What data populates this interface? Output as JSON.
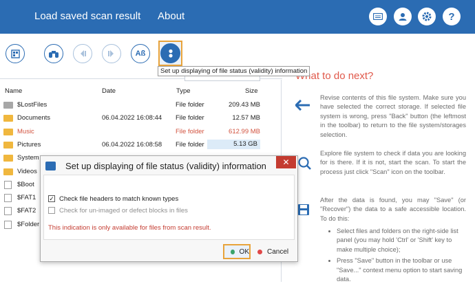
{
  "topbar": {
    "menu": [
      "Load saved scan result",
      "About"
    ],
    "icons": [
      "keyboard-icon",
      "user-icon",
      "gear-icon",
      "help-icon"
    ],
    "help_glyph": "?"
  },
  "toolbar": {
    "buttons": [
      "view-mode-icon",
      "binoculars-icon",
      "back-icon",
      "forward-icon",
      "case-sensitive-icon",
      "file-status-icon"
    ],
    "case_label": "Aß",
    "tooltip": "Set up displaying of file status (validity) information"
  },
  "filelist": {
    "columns": {
      "name": "Name",
      "date": "Date",
      "type": "Type",
      "size": "Size"
    },
    "rows": [
      {
        "name": "$LostFiles",
        "date": "",
        "type": "File folder",
        "size": "209.43 MB",
        "icon": "folder-gray"
      },
      {
        "name": "Documents",
        "date": "06.04.2022 16:08:44",
        "type": "File folder",
        "size": "12.57 MB",
        "icon": "folder"
      },
      {
        "name": "Music",
        "date": "",
        "type": "File folder",
        "size": "612.99 MB",
        "icon": "folder",
        "status": "red"
      },
      {
        "name": "Pictures",
        "date": "06.04.2022 16:08:58",
        "type": "File folder",
        "size": "5.13 GB",
        "icon": "folder",
        "highlight": true
      },
      {
        "name": "System",
        "date": "",
        "type": "",
        "size": "",
        "icon": "folder"
      },
      {
        "name": "Videos",
        "date": "",
        "type": "",
        "size": "",
        "icon": "folder"
      },
      {
        "name": "$Boot",
        "date": "",
        "type": "",
        "size": "",
        "icon": "file"
      },
      {
        "name": "$FAT1",
        "date": "",
        "type": "",
        "size": "",
        "icon": "file"
      },
      {
        "name": "$FAT2",
        "date": "",
        "type": "",
        "size": "",
        "icon": "file"
      },
      {
        "name": "$Folder",
        "date": "",
        "type": "",
        "size": "",
        "icon": "file"
      }
    ]
  },
  "help": {
    "title": "What to do next?",
    "p1": "Revise contents of this file system. Make sure you have selected the correct storage. If selected file system is wrong, press \"Back\" button (the leftmost in the toolbar) to return to the file system/storages selection.",
    "p2": "Explore file system to check if data you are looking for is there. If it is not, start the scan. To start the process just click \"Scan\" icon on the toolbar.",
    "p3": "After the data is found, you may \"Save\" (or \"Recover\") the data to a safe accessible location. To do this:",
    "bullets": [
      "Select files and folders on the right-side list panel (you may hold 'Ctrl' or 'Shift' key to make multiple choice);",
      "Press \"Save\" button in the toolbar or use \"Save...\" context menu option to start saving data."
    ]
  },
  "dialog": {
    "title": "Set up displaying of file status (validity) information",
    "close": "✕",
    "option1": "Check file headers to match known types",
    "option1_checked": true,
    "check_mark": "✓",
    "option2": "Check for un-imaged or defect blocks in files",
    "option2_checked": false,
    "note": "This indication is only available for files from scan result.",
    "ok": "OK",
    "cancel": "Cancel"
  },
  "colors": {
    "brand": "#2b6cb3",
    "accent_red": "#e0584a",
    "highlight": "#e8a33a",
    "ok_dot": "#3aa36a",
    "cancel_dot": "#e04848"
  }
}
